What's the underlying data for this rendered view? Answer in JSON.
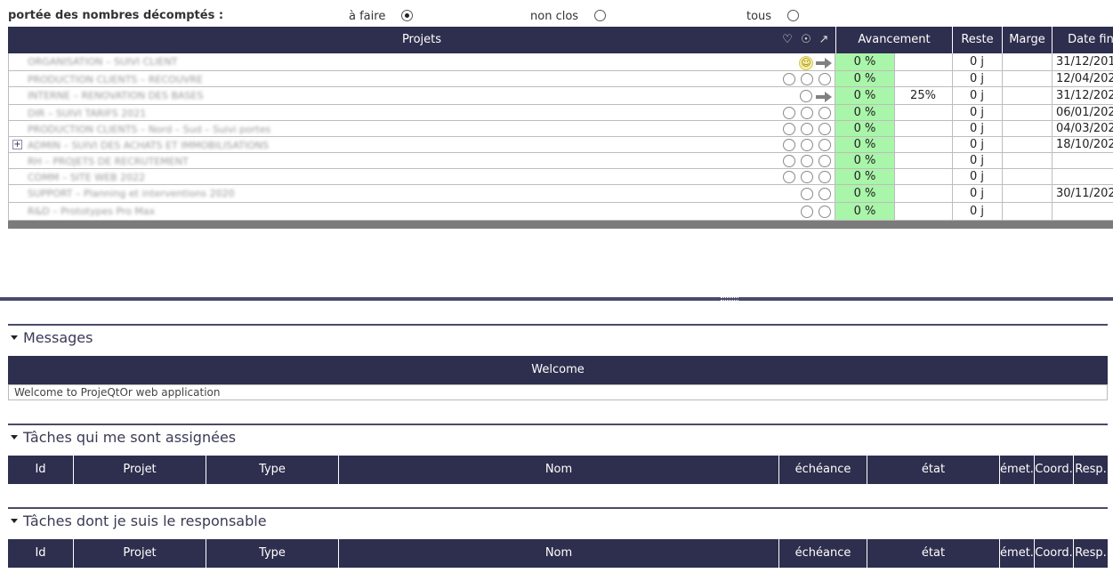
{
  "scope": {
    "label": "portée des nombres décomptés :",
    "options": [
      {
        "label": "à faire",
        "selected": true
      },
      {
        "label": "non clos",
        "selected": false
      },
      {
        "label": "tous",
        "selected": false
      }
    ]
  },
  "projects_table": {
    "columns": {
      "projects": "Projets",
      "progress": "Avancement",
      "remaining": "Reste",
      "margin": "Marge",
      "end_date": "Date fin"
    },
    "header_icons": [
      "health-icon",
      "quality-icon",
      "trend-icon"
    ],
    "rows": [
      {
        "name": "ORGANISATION – SUIVI CLIENT",
        "expandable": false,
        "indicators": [
          "smile",
          "arrow"
        ],
        "progress": "0 %",
        "planned": "",
        "remaining": "0 j",
        "end": "31/12/201"
      },
      {
        "name": "PRODUCTION CLIENTS – RECOUVRE",
        "expandable": false,
        "indicators": [
          "circle",
          "circle",
          "circle"
        ],
        "progress": "0 %",
        "planned": "",
        "remaining": "0 j",
        "end": "12/04/202"
      },
      {
        "name": "INTERNE – RENOVATION DES BASES",
        "expandable": false,
        "indicators": [
          "circle",
          "arrow"
        ],
        "progress": "0 %",
        "planned": "25%",
        "remaining": "0 j",
        "end": "31/12/202"
      },
      {
        "name": "DIR – SUIVI TARIFS 2021",
        "expandable": false,
        "indicators": [
          "circle",
          "circle",
          "circle"
        ],
        "progress": "0 %",
        "planned": "",
        "remaining": "0 j",
        "end": "06/01/202"
      },
      {
        "name": "PRODUCTION CLIENTS – Nord – Sud – Suivi portes",
        "expandable": false,
        "indicators": [
          "circle",
          "circle",
          "circle"
        ],
        "progress": "0 %",
        "planned": "",
        "remaining": "0 j",
        "end": "04/03/202"
      },
      {
        "name": "ADMIN – SUIVI DES ACHATS ET IMMOBILISATIONS",
        "expandable": true,
        "indicators": [
          "circle",
          "circle",
          "circle"
        ],
        "progress": "0 %",
        "planned": "",
        "remaining": "0 j",
        "end": "18/10/202"
      },
      {
        "name": "RH – PROJETS DE RECRUTEMENT",
        "expandable": false,
        "indicators": [
          "circle",
          "circle",
          "circle"
        ],
        "progress": "0 %",
        "planned": "",
        "remaining": "0 j",
        "end": ""
      },
      {
        "name": "COMM – SITE WEB 2022",
        "expandable": false,
        "indicators": [
          "circle",
          "circle",
          "circle"
        ],
        "progress": "0 %",
        "planned": "",
        "remaining": "0 j",
        "end": ""
      },
      {
        "name": "SUPPORT – Planning et interventions 2020",
        "expandable": false,
        "indicators": [
          "circle",
          "circle"
        ],
        "progress": "0 %",
        "planned": "",
        "remaining": "0 j",
        "end": "30/11/202"
      },
      {
        "name": "R&D – Prototypes Pro Max",
        "expandable": false,
        "indicators": [
          "circle",
          "circle"
        ],
        "progress": "0 %",
        "planned": "",
        "remaining": "0 j",
        "end": ""
      }
    ]
  },
  "messages": {
    "title": "Messages",
    "header": "Welcome",
    "body": "Welcome to ProjeQtOr web application"
  },
  "assigned_tasks": {
    "title": "Tâches qui me sont assignées",
    "columns": [
      "Id",
      "Projet",
      "Type",
      "Nom",
      "échéance",
      "état",
      "émet.",
      "Coord.",
      "Resp."
    ]
  },
  "responsible_tasks": {
    "title": "Tâches dont je suis le responsable",
    "columns": [
      "Id",
      "Projet",
      "Type",
      "Nom",
      "échéance",
      "état",
      "émet.",
      "Coord.",
      "Resp."
    ]
  },
  "colors": {
    "header_bg": "#2e2e4e",
    "progress_bg": "#a9f5a9",
    "section_line": "#4a4a6a"
  }
}
